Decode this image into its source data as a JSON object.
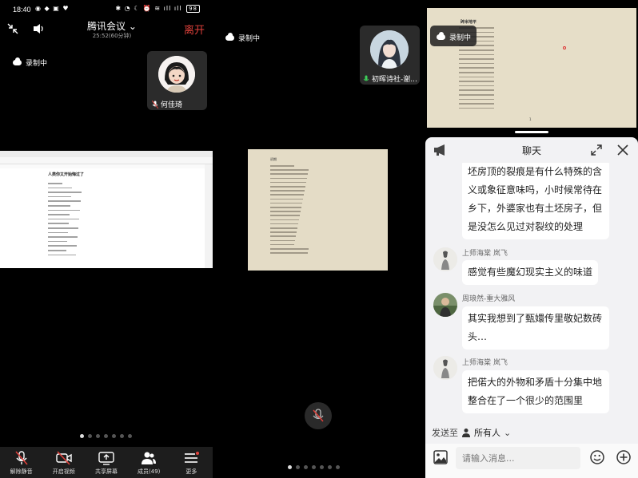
{
  "status": {
    "time": "18:40",
    "battery": "98"
  },
  "meeting": {
    "title": "腾讯会议",
    "timer": "25:52(60分钟)",
    "leave_label": "离开"
  },
  "recording_label": "录制中",
  "participants": [
    {
      "name": "何佳琦"
    },
    {
      "name": "初晖诗社-谢..."
    }
  ],
  "shared_doc": {
    "title": "人类你又开始悔过了"
  },
  "paper_doc": {
    "title": "初期"
  },
  "paper_doc3": {
    "title": "碎米地平",
    "page": "1"
  },
  "toolbar": [
    {
      "label": "解除静音",
      "icon": "mic-muted-icon"
    },
    {
      "label": "开启视频",
      "icon": "camera-off-icon"
    },
    {
      "label": "共享屏幕",
      "icon": "share-screen-icon"
    },
    {
      "label": "成员(49)",
      "icon": "members-icon"
    },
    {
      "label": "更多",
      "icon": "more-menu-icon"
    }
  ],
  "chat": {
    "title": "聊天",
    "messages": [
      {
        "sender": "",
        "text": "坯房顶的裂痕是有什么特殊的含义或象征意味吗，小时候常待在乡下，外婆家也有土坯房子，但是没怎么见过对裂纹的处理"
      },
      {
        "sender": "上师海棠 岚飞",
        "text": "感觉有些魔幻现实主义的味道"
      },
      {
        "sender": "周琅然-重大雅风",
        "text": "其实我想到了甄嬛传里敬妃数砖头…"
      },
      {
        "sender": "上师海棠 岚飞",
        "text": "把偌大的外物和矛盾十分集中地整合在了一个很少的范围里"
      }
    ],
    "send_to_label": "发送至",
    "send_to_target": "所有人",
    "input_placeholder": "请输入消息..."
  },
  "colors": {
    "leave": "#e0413b",
    "chat_bg": "#f2f2f4",
    "paper": "#e4dcc6"
  }
}
